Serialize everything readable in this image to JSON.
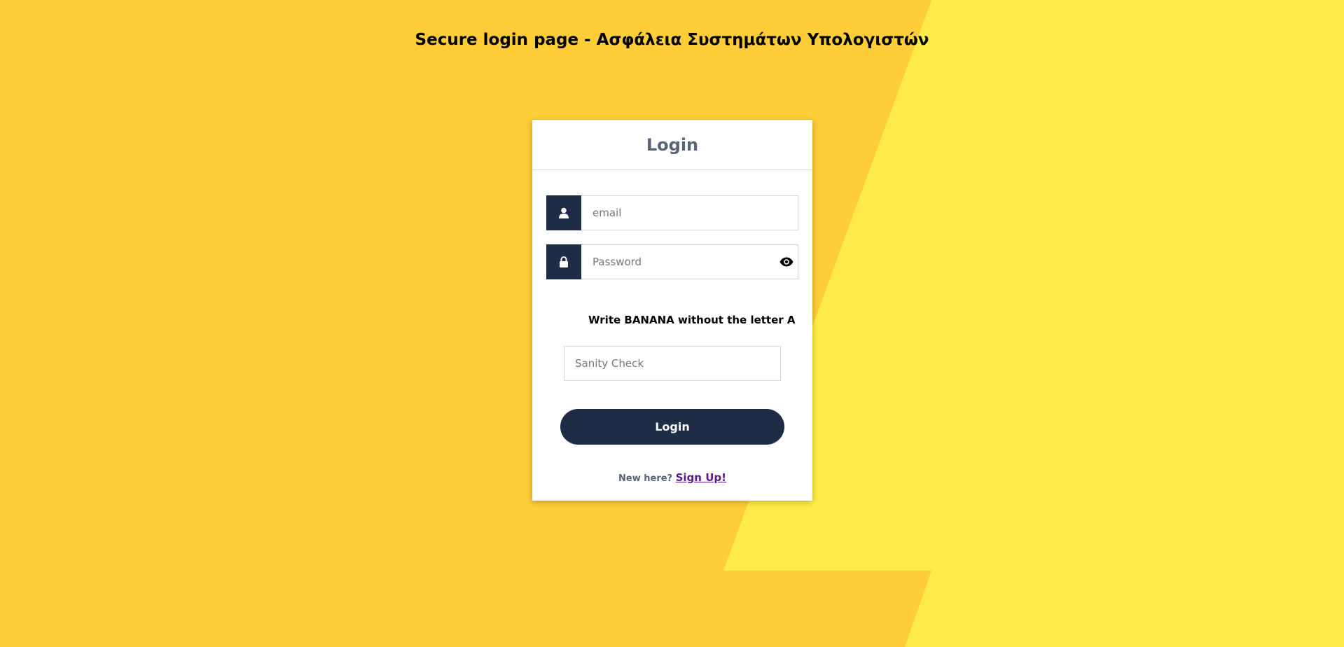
{
  "page": {
    "title": "Secure login page - Ασφάλεια Συστημάτων Υπολογιστών"
  },
  "colors": {
    "background_primary": "#fecd37",
    "background_secondary": "#ffeb47",
    "button": "#1e2d45",
    "card_title": "#5a6478",
    "link": "#5a1a8c"
  },
  "login_card": {
    "title": "Login",
    "email": {
      "icon": "user-icon",
      "placeholder": "email",
      "value": ""
    },
    "password": {
      "icon": "lock-icon",
      "toggle_icon": "eye-icon",
      "placeholder": "Password",
      "value": ""
    },
    "captcha": {
      "question": "Write BANANA without the letter A",
      "placeholder": "Sanity Check",
      "value": ""
    },
    "submit_label": "Login",
    "signup": {
      "prompt": "New here?",
      "link_label": "Sign Up!"
    }
  }
}
